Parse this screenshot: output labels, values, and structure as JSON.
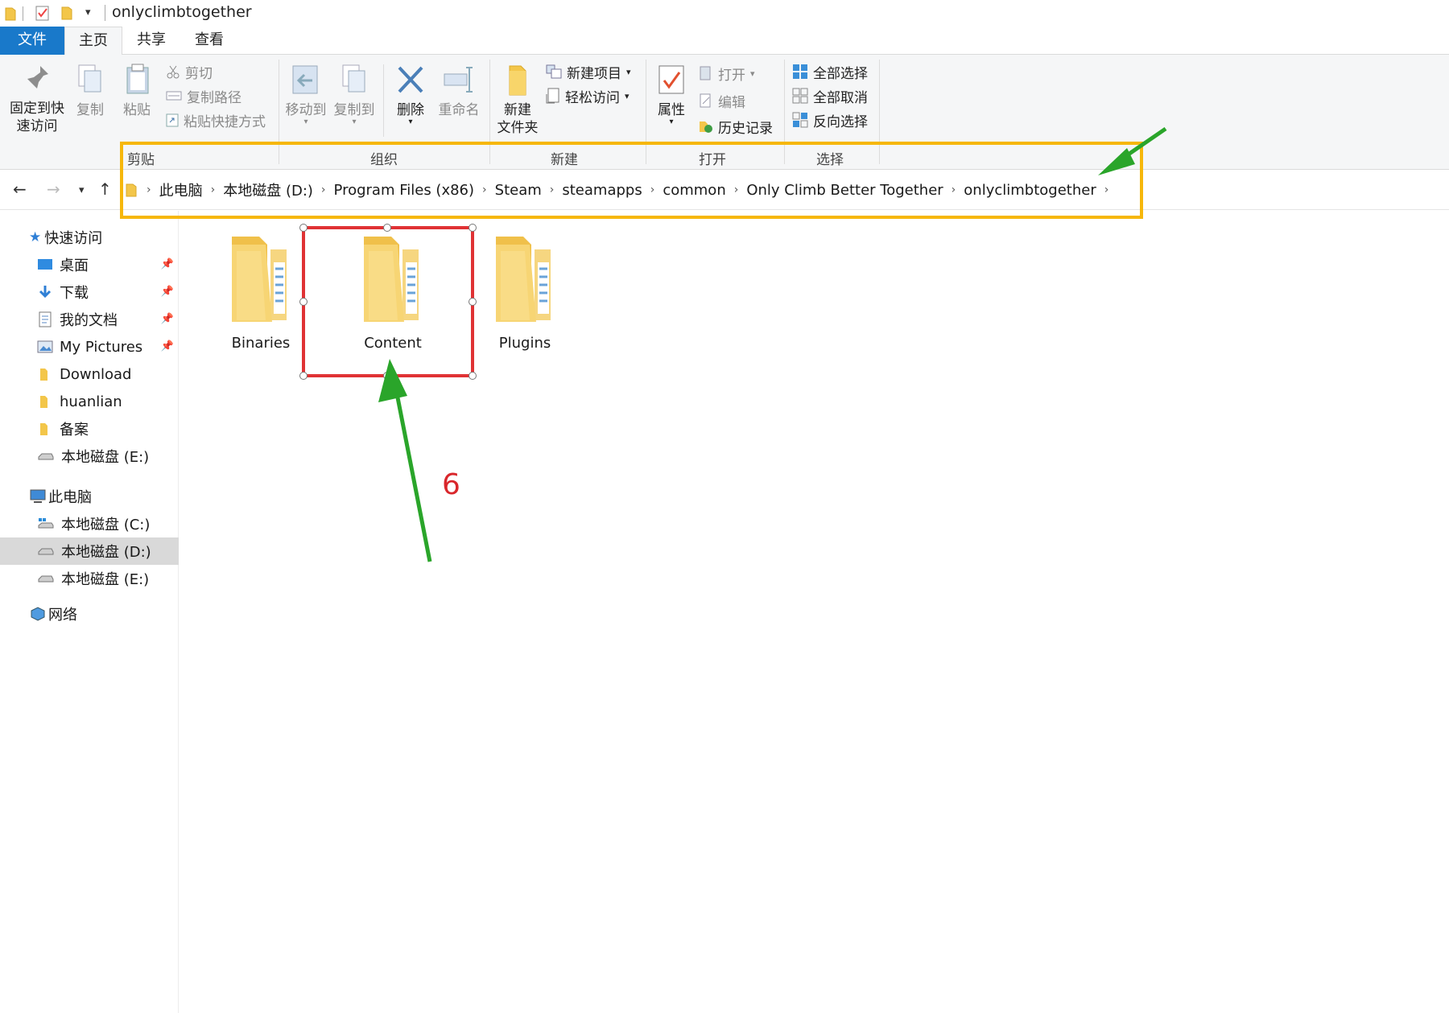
{
  "window": {
    "title": "onlyclimbtogether"
  },
  "tabs": [
    {
      "label": "文件"
    },
    {
      "label": "主页"
    },
    {
      "label": "共享"
    },
    {
      "label": "查看"
    }
  ],
  "ribbon": {
    "clipboard": {
      "group_label": "剪贴板",
      "pin_label_1": "固定到快",
      "pin_label_2": "速访问",
      "copy": "复制",
      "paste": "粘贴",
      "cut": "剪切",
      "copy_path": "复制路径",
      "paste_shortcut": "粘贴快捷方式"
    },
    "organize": {
      "group_label": "组织",
      "move_to": "移动到",
      "copy_to": "复制到",
      "delete": "删除",
      "rename": "重命名"
    },
    "new": {
      "group_label": "新建",
      "new_folder_1": "新建",
      "new_folder_2": "文件夹",
      "new_item": "新建项目",
      "easy_access": "轻松访问"
    },
    "open": {
      "group_label": "打开",
      "properties": "属性",
      "open": "打开",
      "edit": "编辑",
      "history": "历史记录"
    },
    "select": {
      "group_label": "选择",
      "select_all": "全部选择",
      "select_none": "全部取消",
      "invert": "反向选择"
    }
  },
  "address": {
    "crumbs": [
      "此电脑",
      "本地磁盘 (D:)",
      "Program Files (x86)",
      "Steam",
      "steamapps",
      "common",
      "Only Climb Better Together",
      "onlyclimbtogether"
    ]
  },
  "sidebar": {
    "quick_access": "快速访问",
    "items": [
      {
        "label": "桌面"
      },
      {
        "label": "下载"
      },
      {
        "label": "我的文档"
      },
      {
        "label": "My Pictures"
      },
      {
        "label": "Download"
      },
      {
        "label": "huanlian"
      },
      {
        "label": "备案"
      },
      {
        "label": "本地磁盘 (E:)"
      }
    ],
    "this_pc": "此电脑",
    "drives": [
      {
        "label": "本地磁盘 (C:)"
      },
      {
        "label": "本地磁盘 (D:)"
      },
      {
        "label": "本地磁盘 (E:)"
      }
    ],
    "network": "网络"
  },
  "folders": [
    {
      "name": "Binaries"
    },
    {
      "name": "Content"
    },
    {
      "name": "Plugins"
    }
  ],
  "annotations": {
    "step": "6"
  },
  "colors": {
    "accent": "#1979ca",
    "highlight_orange": "#f6b70b",
    "highlight_red": "#e03234",
    "arrow_green": "#2aa52a"
  }
}
